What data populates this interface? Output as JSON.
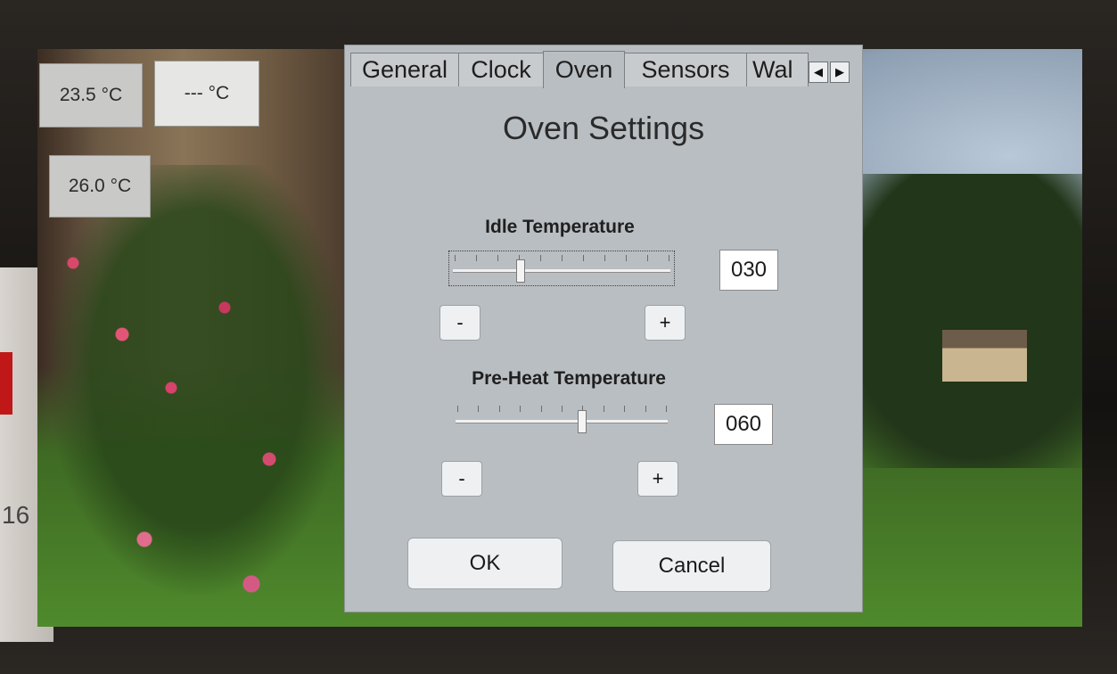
{
  "temperatures": {
    "reading_1": "23.5 °C",
    "reading_2": "--- °C",
    "reading_3": "26.0 °C"
  },
  "tabs": [
    {
      "label": "General"
    },
    {
      "label": "Clock"
    },
    {
      "label": "Oven"
    },
    {
      "label": "Sensors"
    },
    {
      "label": "Wal"
    }
  ],
  "active_tab": "Oven",
  "tab_scroll": {
    "left": "◀",
    "right": "▶"
  },
  "dialog": {
    "title": "Oven Settings",
    "idle": {
      "label": "Idle Temperature",
      "value": "030",
      "level": 0.3,
      "decrement": "-",
      "increment": "+"
    },
    "preheat": {
      "label": "Pre-Heat Temperature",
      "value": "060",
      "level": 0.6,
      "decrement": "-",
      "increment": "+"
    },
    "ok_label": "OK",
    "cancel_label": "Cancel"
  },
  "background_number": "16"
}
